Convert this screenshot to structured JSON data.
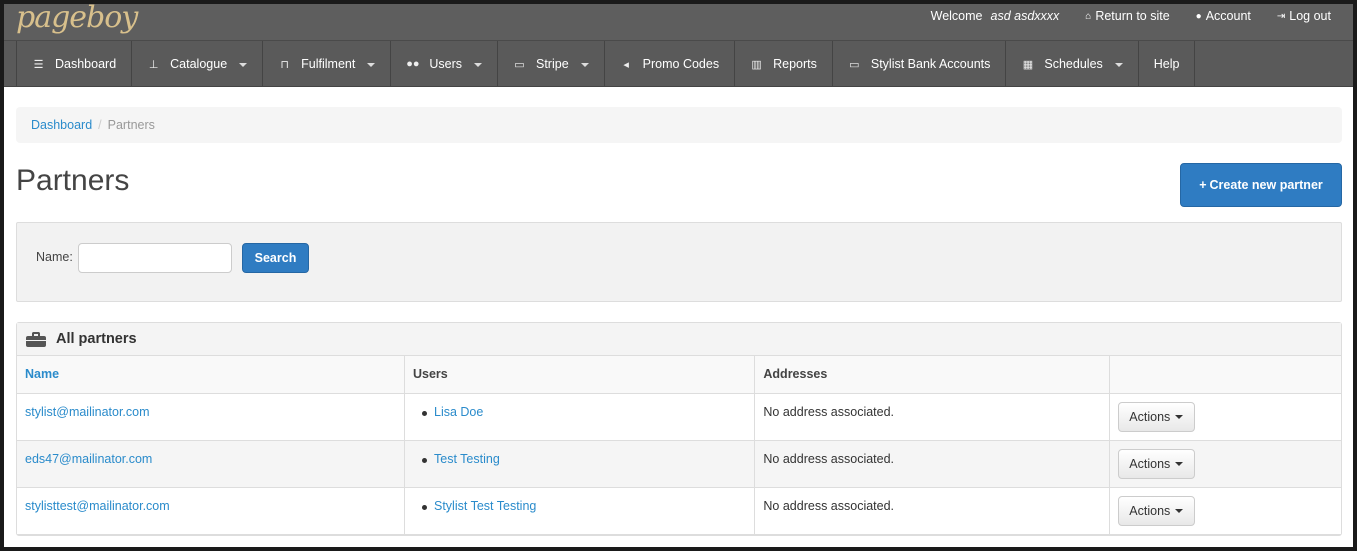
{
  "topbar": {
    "logo": "pageboy",
    "welcome_prefix": "Welcome",
    "username": "asd asdxxxx",
    "return_to_site": "Return to site",
    "account": "Account",
    "logout": "Log out"
  },
  "nav": {
    "items": [
      {
        "label": "Dashboard",
        "icon": "list-icon",
        "dropdown": false
      },
      {
        "label": "Catalogue",
        "icon": "sitemap-icon",
        "dropdown": true
      },
      {
        "label": "Fulfilment",
        "icon": "cart-icon",
        "dropdown": true
      },
      {
        "label": "Users",
        "icon": "users-icon",
        "dropdown": true
      },
      {
        "label": "Stripe",
        "icon": "credit-card-icon",
        "dropdown": true
      },
      {
        "label": "Promo Codes",
        "icon": "bullhorn-icon",
        "dropdown": false
      },
      {
        "label": "Reports",
        "icon": "bar-chart-icon",
        "dropdown": false
      },
      {
        "label": "Stylist Bank Accounts",
        "icon": "credit-card-icon",
        "dropdown": false
      },
      {
        "label": "Schedules",
        "icon": "calendar-icon",
        "dropdown": true
      },
      {
        "label": "Help",
        "icon": "",
        "dropdown": false
      }
    ]
  },
  "breadcrumb": {
    "home": "Dashboard",
    "separator": "/",
    "current": "Partners"
  },
  "page": {
    "title": "Partners",
    "create_button": "Create new partner"
  },
  "search": {
    "name_label": "Name:",
    "name_value": "",
    "button": "Search"
  },
  "partners_panel": {
    "title": "All partners",
    "columns": [
      "Name",
      "Users",
      "Addresses",
      ""
    ],
    "rows": [
      {
        "name": "stylist@mailinator.com",
        "user": "Lisa Doe",
        "address": "No address associated.",
        "action": "Actions"
      },
      {
        "name": "eds47@mailinator.com",
        "user": "Test Testing",
        "address": "No address associated.",
        "action": "Actions"
      },
      {
        "name": "stylisttest@mailinator.com",
        "user": "Stylist Test Testing",
        "address": "No address associated.",
        "action": "Actions"
      }
    ]
  },
  "colors": {
    "topbar": "#5e5e5e",
    "navbar": "#5a5a5a",
    "primary": "#2f7cc2",
    "link": "#2a8bcb",
    "logo": "#d8c08c"
  }
}
